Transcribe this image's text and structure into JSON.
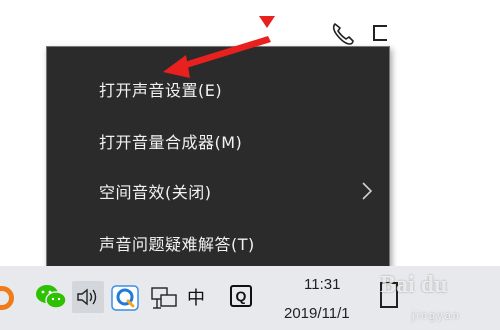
{
  "context_menu": {
    "items": [
      {
        "label": "打开声音设置(E)"
      },
      {
        "label": "打开音量合成器(M)"
      },
      {
        "label": "空间音效(关闭)",
        "has_submenu": true
      },
      {
        "label": "声音问题疑难解答(T)"
      }
    ]
  },
  "taskbar": {
    "input_method": "中",
    "ime_badge": "Q",
    "clock_time": "11:31",
    "clock_date": "2019/11/1"
  },
  "watermark": {
    "text": "Bai du",
    "sub": "jingyan"
  },
  "colors": {
    "menu_bg": "#2b2b2b",
    "menu_text": "#f2f2f2",
    "annotation_red": "#e8211e",
    "taskbar_bg": "#e7e9ec"
  },
  "icons": [
    "phone-icon",
    "square-icon",
    "chevron-right-icon",
    "wechat-icon",
    "volume-icon",
    "qq-icon",
    "network-icon",
    "ime-q-icon",
    "notification-icon"
  ]
}
